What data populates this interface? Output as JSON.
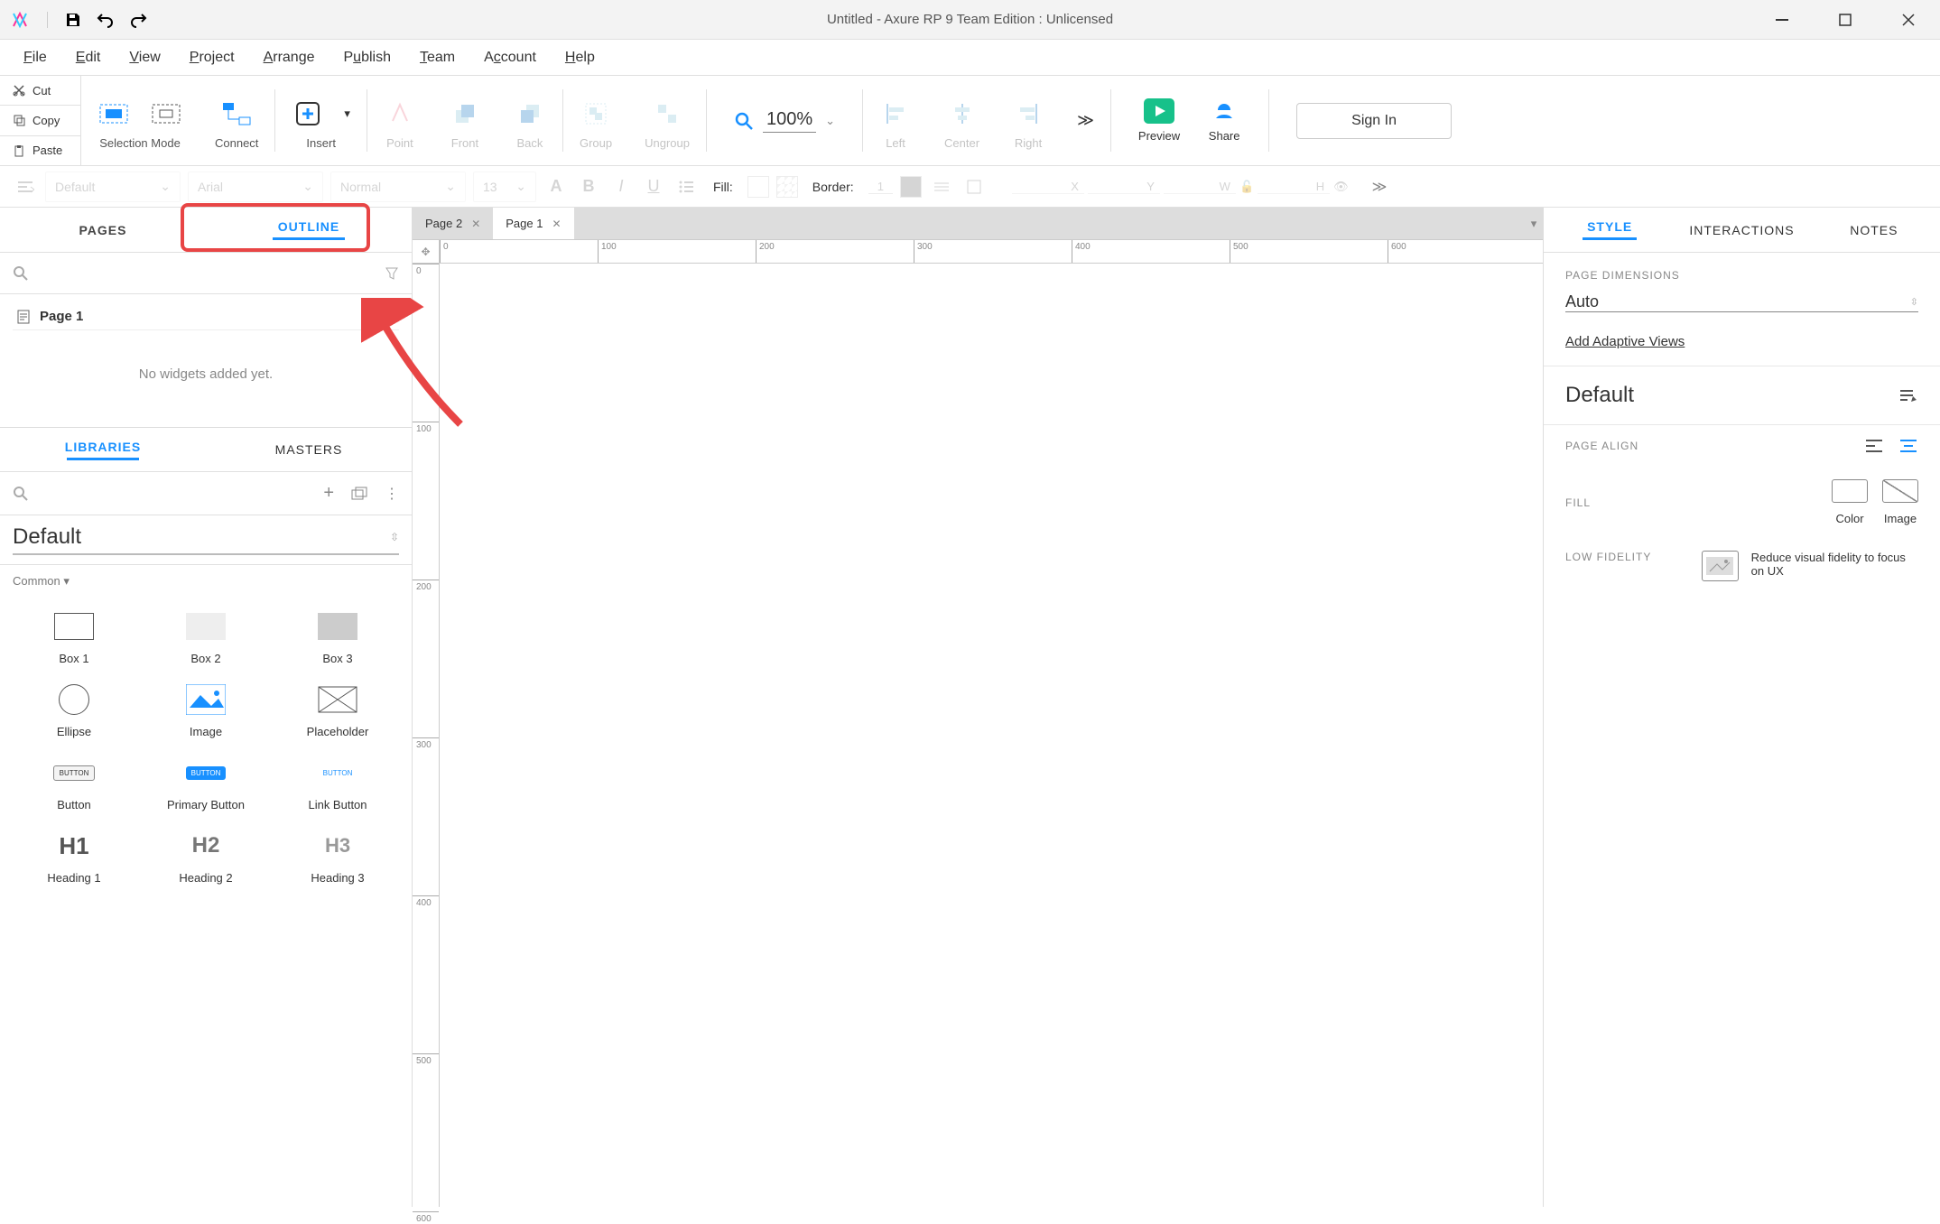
{
  "title": "Untitled - Axure RP 9 Team Edition : Unlicensed",
  "menubar": [
    "File",
    "Edit",
    "View",
    "Project",
    "Arrange",
    "Publish",
    "Team",
    "Account",
    "Help"
  ],
  "leftActions": {
    "cut": "Cut",
    "copy": "Copy",
    "paste": "Paste"
  },
  "toolbar": {
    "selectionMode": "Selection Mode",
    "connect": "Connect",
    "insert": "Insert",
    "point": "Point",
    "front": "Front",
    "back": "Back",
    "group": "Group",
    "ungroup": "Ungroup",
    "zoom": "100%",
    "left": "Left",
    "center": "Center",
    "right": "Right",
    "preview": "Preview",
    "share": "Share",
    "signin": "Sign In"
  },
  "stylebar": {
    "style": "Default",
    "font": "Arial",
    "weight": "Normal",
    "size": "13",
    "fillLabel": "Fill:",
    "borderLabel": "Border:",
    "borderWidth": "1",
    "x": "X",
    "y": "Y",
    "w": "W",
    "h": "H"
  },
  "leftPanel": {
    "tabPages": "PAGES",
    "tabOutline": "OUTLINE",
    "page1": "Page 1",
    "emptyMsg": "No widgets added yet.",
    "tabLibraries": "LIBRARIES",
    "tabMasters": "MASTERS",
    "librarySelect": "Default",
    "categoryCommon": "Common ▾",
    "widgets": [
      {
        "name": "Box 1"
      },
      {
        "name": "Box 2"
      },
      {
        "name": "Box 3"
      },
      {
        "name": "Ellipse"
      },
      {
        "name": "Image"
      },
      {
        "name": "Placeholder"
      },
      {
        "name": "Button"
      },
      {
        "name": "Primary Button"
      },
      {
        "name": "Link Button"
      },
      {
        "name": "Heading 1"
      },
      {
        "name": "Heading 2"
      },
      {
        "name": "Heading 3"
      }
    ]
  },
  "canvas": {
    "tab1": "Page 2",
    "tab2": "Page 1",
    "rulerH": [
      "0",
      "100",
      "200",
      "300",
      "400",
      "500",
      "600"
    ],
    "rulerV": [
      "0",
      "100",
      "200",
      "300",
      "400",
      "500",
      "600"
    ]
  },
  "rightPanel": {
    "tabStyle": "STYLE",
    "tabInteractions": "INTERACTIONS",
    "tabNotes": "NOTES",
    "pageDimensions": "PAGE DIMENSIONS",
    "auto": "Auto",
    "addAdaptive": "Add Adaptive Views",
    "defaultHeading": "Default",
    "pageAlign": "PAGE ALIGN",
    "fill": "FILL",
    "fillColor": "Color",
    "fillImage": "Image",
    "lowFidelity": "LOW FIDELITY",
    "lowFidelityDesc": "Reduce visual fidelity to focus on UX"
  }
}
